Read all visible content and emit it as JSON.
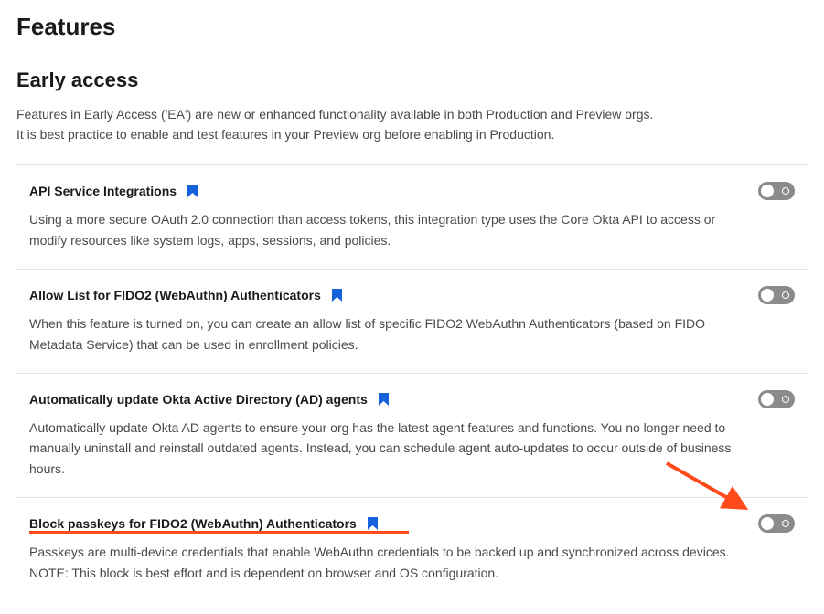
{
  "page": {
    "title": "Features"
  },
  "section": {
    "title": "Early access",
    "description_line1": "Features in Early Access ('EA') are new or enhanced functionality available in both Production and Preview orgs.",
    "description_line2": "It is best practice to enable and test features in your Preview org before enabling in Production."
  },
  "features": [
    {
      "title": "API Service Integrations",
      "description": "Using a more secure OAuth 2.0 connection than access tokens, this integration type uses the Core Okta API to access or modify resources like system logs, apps, sessions, and policies.",
      "enabled": false
    },
    {
      "title": "Allow List for FIDO2 (WebAuthn) Authenticators",
      "description": "When this feature is turned on, you can create an allow list of specific FIDO2 WebAuthn Authenticators (based on FIDO Metadata Service) that can be used in enrollment policies.",
      "enabled": false
    },
    {
      "title": "Automatically update Okta Active Directory (AD) agents",
      "description": "Automatically update Okta AD agents to ensure your org has the latest agent features and functions. You no longer need to manually uninstall and reinstall outdated agents. Instead, you can schedule agent auto-updates to occur outside of business hours.",
      "enabled": false
    },
    {
      "title": "Block passkeys for FIDO2 (WebAuthn) Authenticators",
      "description": "Passkeys are multi-device credentials that enable WebAuthn credentials to be backed up and synchronized across devices. NOTE: This block is best effort and is dependent on browser and OS configuration.",
      "enabled": false
    }
  ],
  "colors": {
    "icon_blue": "#1662dd",
    "annotation_orange": "#ff4a1c"
  }
}
